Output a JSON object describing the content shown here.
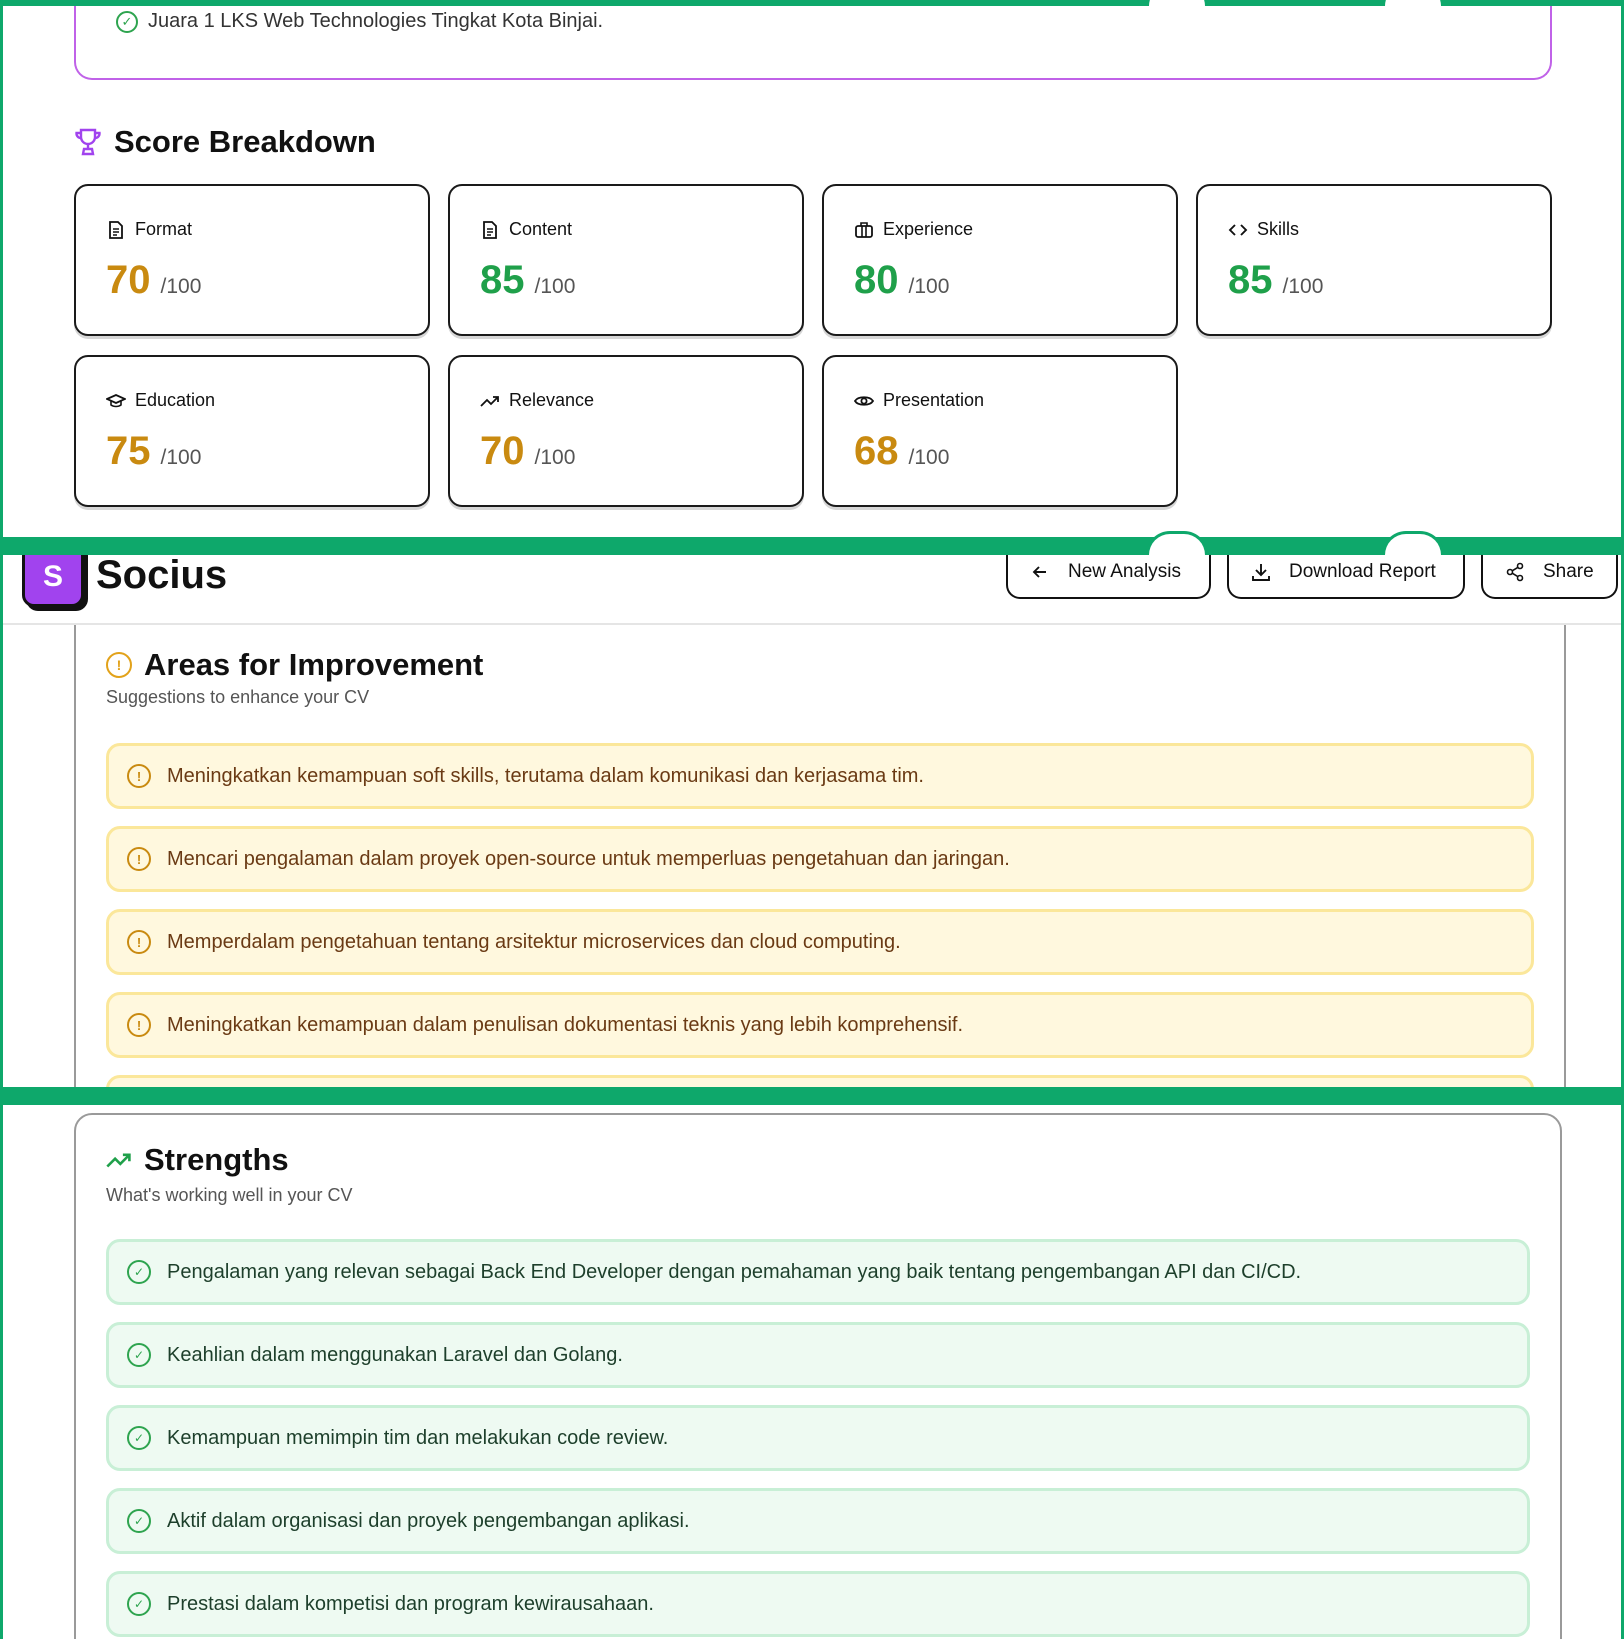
{
  "achievement": {
    "text": "Juara 1 LKS Web Technologies Tingkat Kota Binjai."
  },
  "score_breakdown": {
    "title": "Score Breakdown",
    "max_label": "/100",
    "items": [
      {
        "label": "Format",
        "score": "70",
        "icon": "document-icon",
        "color": "#c98a10"
      },
      {
        "label": "Content",
        "score": "85",
        "icon": "document-icon",
        "color": "#1fa04a"
      },
      {
        "label": "Experience",
        "score": "80",
        "icon": "briefcase-icon",
        "color": "#1fa04a"
      },
      {
        "label": "Skills",
        "score": "85",
        "icon": "code-icon",
        "color": "#1fa04a"
      },
      {
        "label": "Education",
        "score": "75",
        "icon": "graduation-cap-icon",
        "color": "#c98a10"
      },
      {
        "label": "Relevance",
        "score": "70",
        "icon": "trending-up-icon",
        "color": "#c98a10"
      },
      {
        "label": "Presentation",
        "score": "68",
        "icon": "eye-icon",
        "color": "#c98a10"
      }
    ]
  },
  "header": {
    "logo_letter": "S",
    "app_name": "Socius",
    "brand_color": "#a143ee",
    "buttons": {
      "new_analysis": "New Analysis",
      "download_report": "Download Report",
      "share": "Share"
    }
  },
  "improvements": {
    "title": "Areas for Improvement",
    "subtitle": "Suggestions to enhance your CV",
    "items": [
      "Meningkatkan kemampuan soft skills, terutama dalam komunikasi dan kerjasama tim.",
      "Mencari pengalaman dalam proyek open-source untuk memperluas pengetahuan dan jaringan.",
      "Memperdalam pengetahuan tentang arsitektur microservices dan cloud computing.",
      "Meningkatkan kemampuan dalam penulisan dokumentasi teknis yang lebih komprehensif."
    ]
  },
  "strengths": {
    "title": "Strengths",
    "subtitle": "What's working well in your CV",
    "items": [
      "Pengalaman yang relevan sebagai Back End Developer dengan pemahaman yang baik tentang pengembangan API dan CI/CD.",
      "Keahlian dalam menggunakan Laravel dan Golang.",
      "Kemampuan memimpin tim dan melakukan code review.",
      "Aktif dalam organisasi dan proyek pengembangan aplikasi.",
      "Prestasi dalam kompetisi dan program kewirausahaan."
    ]
  }
}
